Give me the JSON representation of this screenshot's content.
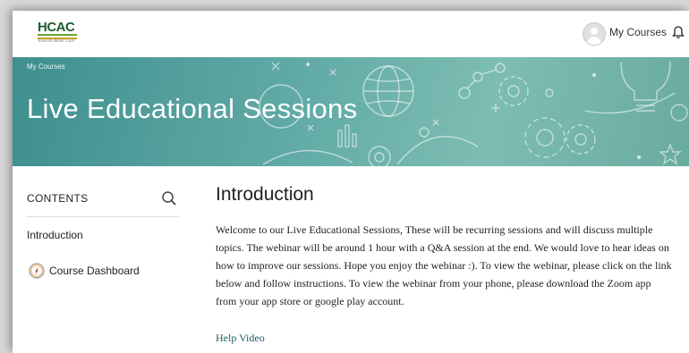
{
  "header": {
    "logo_text": "HCAC",
    "logo_tagline": "Towards Better Care",
    "user_menu_label": "My Courses",
    "icons": {
      "avatar": "user-avatar-icon",
      "notifications": "bell-icon"
    }
  },
  "banner": {
    "breadcrumb": "My Courses",
    "title": "Live Educational Sessions"
  },
  "sidebar": {
    "contents_label": "CONTENTS",
    "items": [
      {
        "label": "Introduction"
      }
    ],
    "dashboard_label": "Course Dashboard",
    "icons": {
      "search": "search-icon",
      "dashboard": "compass-icon"
    }
  },
  "main": {
    "heading": "Introduction",
    "body": "Welcome to our Live Educational Sessions, These will be recurring sessions and will discuss multiple topics. The webinar will be around 1 hour with a Q&A session at the end. We would love to hear ideas on how to improve our sessions. Hope you enjoy the webinar :). To view the webinar, please click on the link below and follow instructions. To view the webinar from your phone, please download the Zoom app from your app store or google play account.",
    "link_label": "Help Video"
  },
  "colors": {
    "banner_teal": "#5fa9a5",
    "logo_green": "#1f5e2e",
    "link_teal": "#1d5f66"
  }
}
